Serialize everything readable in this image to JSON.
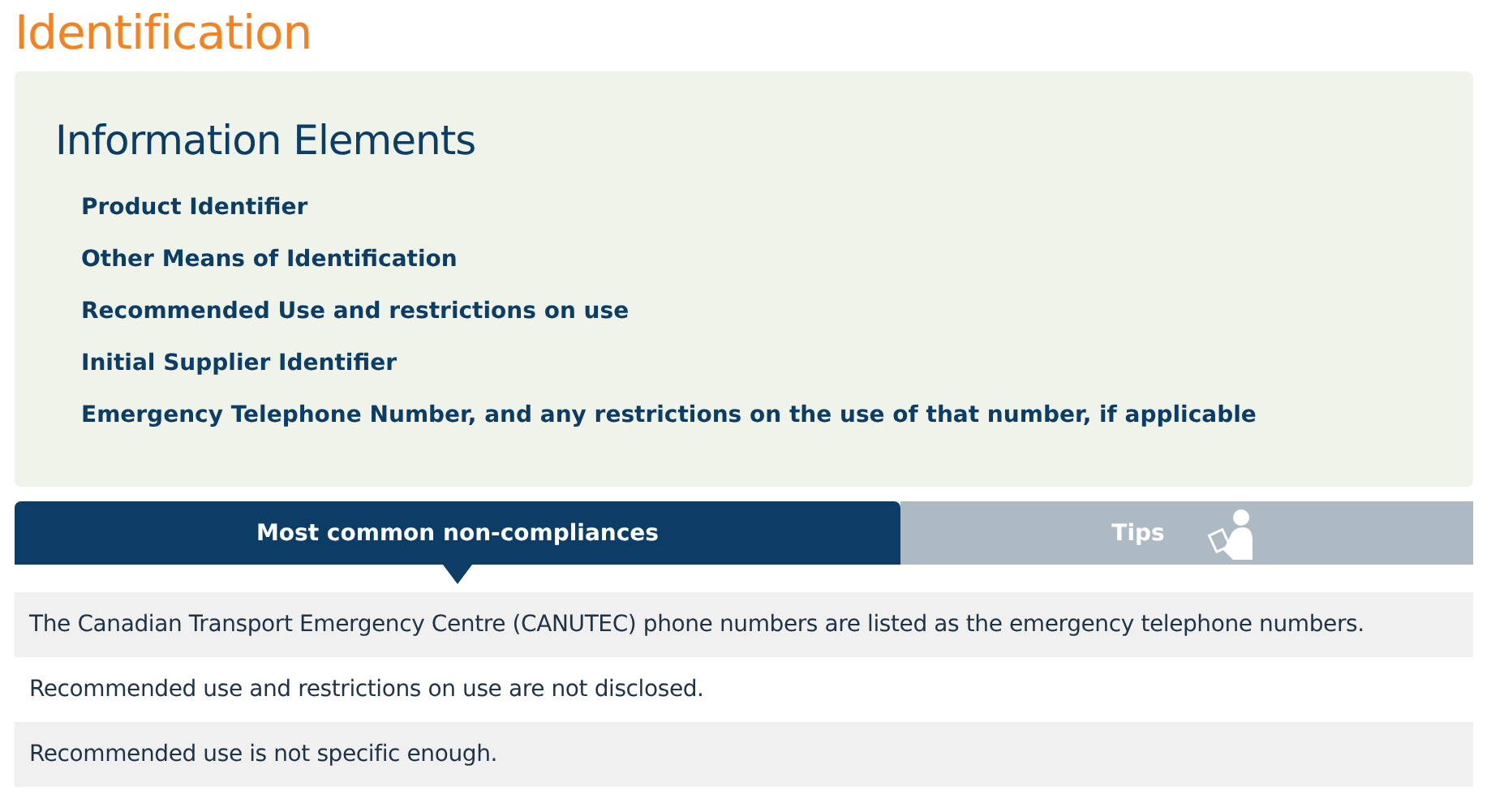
{
  "page_title": "Identification",
  "panel": {
    "heading": "Information Elements",
    "items": [
      "Product Identifier",
      "Other Means of Identification",
      "Recommended Use and restrictions on use",
      "Initial Supplier Identifier",
      "Emergency Telephone Number, and any restrictions on the use of that number, if applicable"
    ]
  },
  "tabs": [
    {
      "label": "Most common non-compliances",
      "selected": true,
      "kind": "text"
    },
    {
      "label": "Tips",
      "selected": false,
      "kind": "reader"
    }
  ],
  "rows": [
    "The Canadian Transport Emergency Centre (CANUTEC) phone numbers are listed as the emergency telephone numbers.",
    "Recommended use and restrictions on use are not disclosed.",
    "Recommended use is not specific enough."
  ]
}
